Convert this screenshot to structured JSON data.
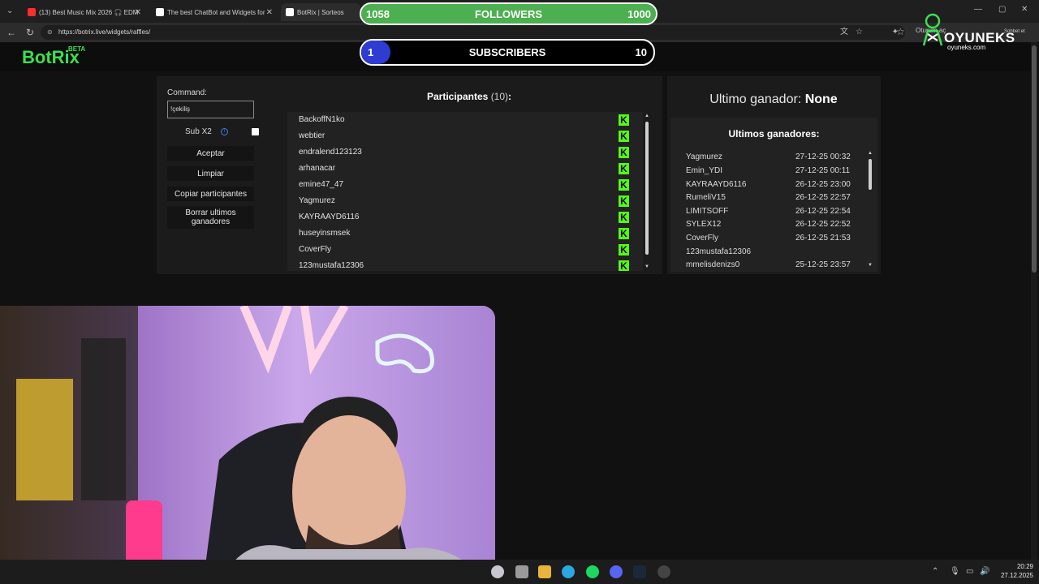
{
  "browser": {
    "tabs": [
      {
        "title": "(13) Best Music Mix 2026 🎧 EDM",
        "favicon_color": "#ff2d2d"
      },
      {
        "title": "The best ChatBot and Widgets for",
        "favicon_color": "#ffffff"
      },
      {
        "title": "BotRix | Sorteos",
        "favicon_color": "#ffffff"
      }
    ],
    "url": "https://botrix.live/widgets/raffles/",
    "profile_label": "Oturum aç",
    "sync_label": "Sohbet et"
  },
  "app": {
    "logo": "BotRix",
    "logo_badge": "BETA",
    "command_label": "Command:",
    "command_value": "!çekiliş",
    "sub_x2_label": "Sub X2",
    "sub_x2_checked": false,
    "buttons": {
      "accept": "Aceptar",
      "clear": "Limpiar",
      "copy": "Copiar participantes",
      "delete_line1": "Borrar ultimos",
      "delete_line2": "ganadores"
    },
    "participants_title": "Participantes",
    "participants_count": "(10)",
    "participants_colon": ":",
    "participants": [
      "BackoffN1ko",
      "webtier",
      "endralend123123",
      "arhanacar",
      "emine47_47",
      "Yagmurez",
      "KAYRAAYD6116",
      "huseyinsmsek",
      "CoverFly",
      "123mustafa12306"
    ],
    "kick_badge": "K",
    "last_winner_label": "Ultimo ganador:",
    "last_winner_value": "None",
    "winners_title": "Ultimos ganadores:",
    "winners": [
      {
        "name": "Yagmurez",
        "date": "27-12-25 00:32"
      },
      {
        "name": "Emin_YDI",
        "date": "27-12-25 00:11"
      },
      {
        "name": "KAYRAAYD6116",
        "date": "26-12-25 23:00"
      },
      {
        "name": "RumeliV15",
        "date": "26-12-25 22:57"
      },
      {
        "name": "LIMITSOFF",
        "date": "26-12-25 22:54"
      },
      {
        "name": "SYLEX12",
        "date": "26-12-25 22:52"
      },
      {
        "name": "CoverFly",
        "date": "26-12-25 21:53"
      },
      {
        "name": "123mustafa12306",
        "date": ""
      },
      {
        "name": "mmelisdenizs0",
        "date": "25-12-25 23:57"
      }
    ]
  },
  "overlay": {
    "followers": {
      "label": "FOLLOWERS",
      "current": "1058",
      "goal": "1000",
      "progress": 1.0
    },
    "subscribers": {
      "label": "SUBSCRIBERS",
      "current": "1",
      "goal": "10",
      "progress": 0.1
    },
    "brand_name": "OYUNEKS",
    "brand_url": "oyuneks.com"
  },
  "taskbar": {
    "time": "20:29",
    "date": "27.12.2025"
  },
  "colors": {
    "accent": "#3be04f",
    "kick": "#53fc18",
    "followers_bar": "#51b951",
    "subs_fill": "#2f3cd1"
  }
}
